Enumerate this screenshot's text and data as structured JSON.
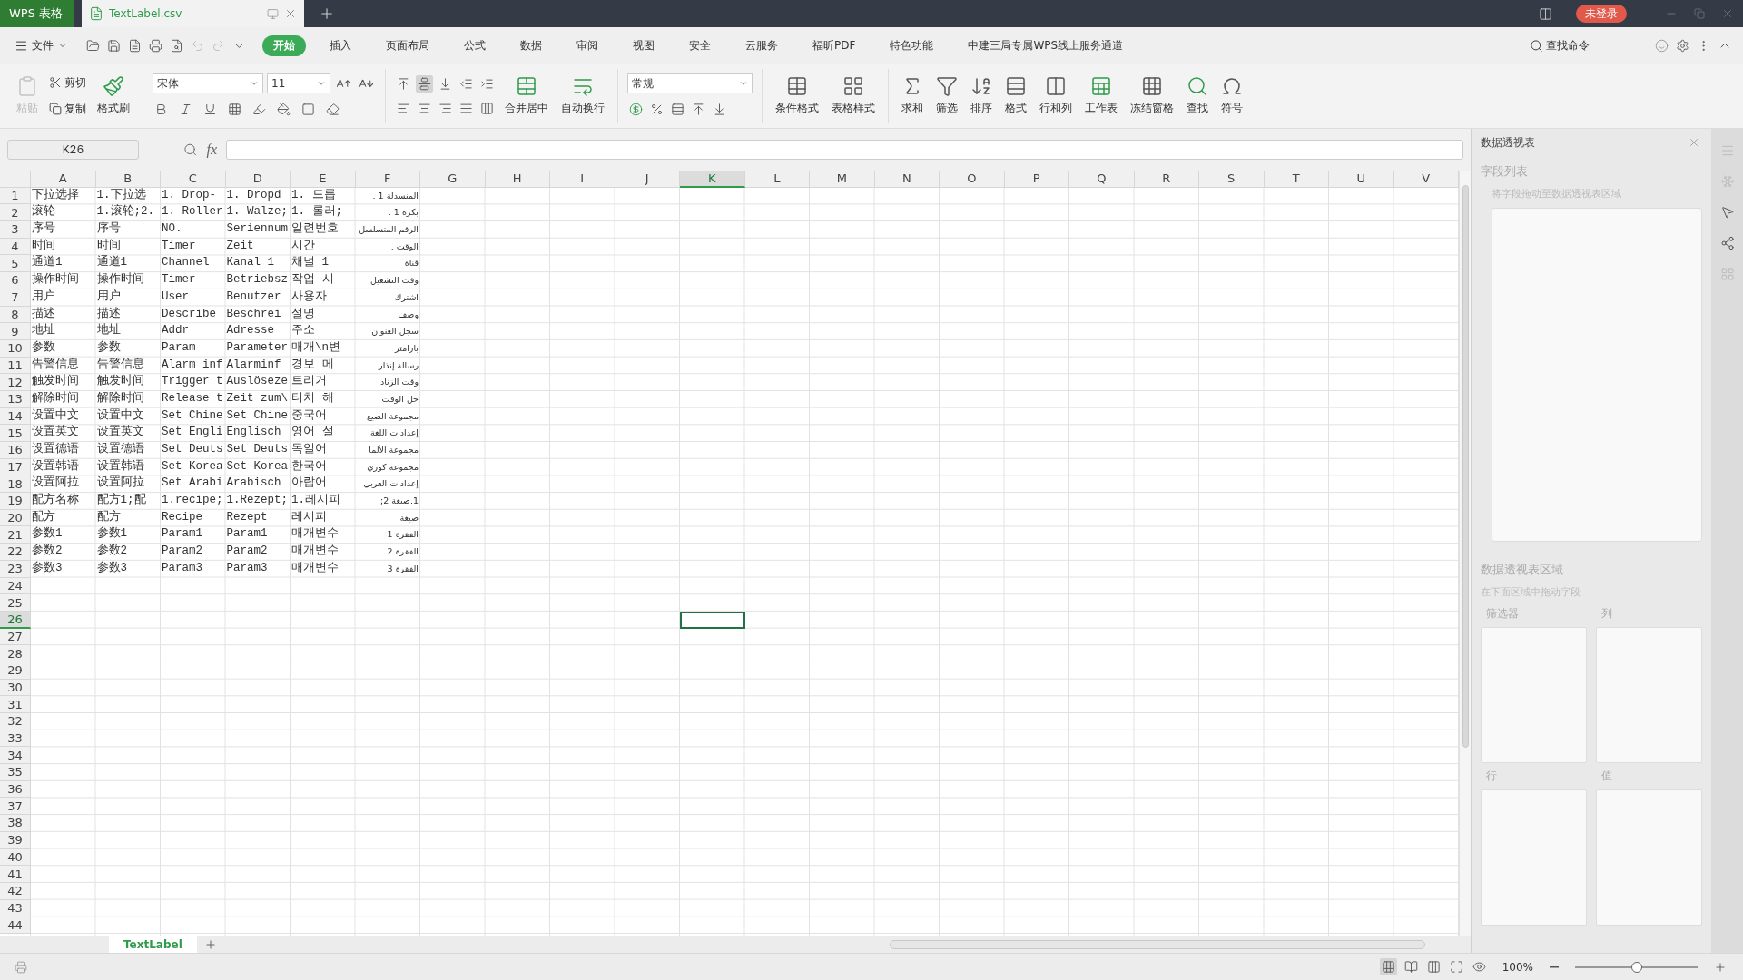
{
  "title_bar": {
    "app_tab": "WPS 表格",
    "doc_tabs": [
      {
        "label": "TextLabel.csv",
        "selected": true
      }
    ],
    "login": "未登录"
  },
  "menu_bar": {
    "file": "文件",
    "tabs": [
      {
        "label": "开始",
        "selected": true
      },
      {
        "label": "插入",
        "selected": false
      },
      {
        "label": "页面布局",
        "selected": false
      },
      {
        "label": "公式",
        "selected": false
      },
      {
        "label": "数据",
        "selected": false
      },
      {
        "label": "审阅",
        "selected": false
      },
      {
        "label": "视图",
        "selected": false
      },
      {
        "label": "安全",
        "selected": false
      },
      {
        "label": "云服务",
        "selected": false
      },
      {
        "label": "福昕PDF",
        "selected": false
      },
      {
        "label": "特色功能",
        "selected": false
      },
      {
        "label": "中建三局专属WPS线上服务通道",
        "selected": false
      }
    ],
    "search": "查找命令"
  },
  "toolbar": {
    "paste": {
      "label": "粘贴",
      "disabled": true
    },
    "cut": "剪切",
    "copy": "复制",
    "format_painter": "格式刷",
    "font": "宋体",
    "font_size": "11",
    "vertical_align": [
      {
        "selected": false
      },
      {
        "selected": true
      },
      {
        "selected": false
      }
    ],
    "merge": "合并居中",
    "wrap": "自动换行",
    "number_format": "常规",
    "tools": [
      "条件格式",
      "表格样式",
      "求和",
      "筛选",
      "排序",
      "格式",
      "行和列",
      "工作表",
      "冻结窗格",
      "查找",
      "符号"
    ]
  },
  "formula_bar": {
    "name_box": "K26",
    "fx": "fx"
  },
  "sheet": {
    "columns": [
      {
        "label": "A",
        "selected": false
      },
      {
        "label": "B",
        "selected": false
      },
      {
        "label": "C",
        "selected": false
      },
      {
        "label": "D",
        "selected": false
      },
      {
        "label": "E",
        "selected": false
      },
      {
        "label": "F",
        "selected": false
      },
      {
        "label": "G",
        "selected": false
      },
      {
        "label": "H",
        "selected": false
      },
      {
        "label": "I",
        "selected": false
      },
      {
        "label": "J",
        "selected": false
      },
      {
        "label": "K",
        "selected": true
      },
      {
        "label": "L",
        "selected": false
      },
      {
        "label": "M",
        "selected": false
      },
      {
        "label": "N",
        "selected": false
      },
      {
        "label": "O",
        "selected": false
      },
      {
        "label": "P",
        "selected": false
      },
      {
        "label": "Q",
        "selected": false
      },
      {
        "label": "R",
        "selected": false
      },
      {
        "label": "S",
        "selected": false
      },
      {
        "label": "T",
        "selected": false
      },
      {
        "label": "U",
        "selected": false
      },
      {
        "label": "V",
        "selected": false
      }
    ],
    "rows": [
      {
        "label": "1",
        "selected": false
      },
      {
        "label": "2",
        "selected": false
      },
      {
        "label": "3",
        "selected": false
      },
      {
        "label": "4",
        "selected": false
      },
      {
        "label": "5",
        "selected": false
      },
      {
        "label": "6",
        "selected": false
      },
      {
        "label": "7",
        "selected": false
      },
      {
        "label": "8",
        "selected": false
      },
      {
        "label": "9",
        "selected": false
      },
      {
        "label": "10",
        "selected": false
      },
      {
        "label": "11",
        "selected": false
      },
      {
        "label": "12",
        "selected": false
      },
      {
        "label": "13",
        "selected": false
      },
      {
        "label": "14",
        "selected": false
      },
      {
        "label": "15",
        "selected": false
      },
      {
        "label": "16",
        "selected": false
      },
      {
        "label": "17",
        "selected": false
      },
      {
        "label": "18",
        "selected": false
      },
      {
        "label": "19",
        "selected": false
      },
      {
        "label": "20",
        "selected": false
      },
      {
        "label": "21",
        "selected": false
      },
      {
        "label": "22",
        "selected": false
      },
      {
        "label": "23",
        "selected": false
      },
      {
        "label": "24",
        "selected": false
      },
      {
        "label": "25",
        "selected": false
      },
      {
        "label": "26",
        "selected": true
      },
      {
        "label": "27",
        "selected": false
      },
      {
        "label": "28",
        "selected": false
      },
      {
        "label": "29",
        "selected": false
      },
      {
        "label": "30",
        "selected": false
      },
      {
        "label": "31",
        "selected": false
      },
      {
        "label": "32",
        "selected": false
      },
      {
        "label": "33",
        "selected": false
      },
      {
        "label": "34",
        "selected": false
      },
      {
        "label": "35",
        "selected": false
      },
      {
        "label": "36",
        "selected": false
      },
      {
        "label": "37",
        "selected": false
      },
      {
        "label": "38",
        "selected": false
      },
      {
        "label": "39",
        "selected": false
      },
      {
        "label": "40",
        "selected": false
      },
      {
        "label": "41",
        "selected": false
      },
      {
        "label": "42",
        "selected": false
      },
      {
        "label": "43",
        "selected": false
      },
      {
        "label": "44",
        "selected": false
      }
    ],
    "cells": [
      [
        "下拉选择",
        "1.下拉选",
        "1. Drop-",
        "1. Dropd",
        "1. 드롭",
        "المنسدلة 1 ."
      ],
      [
        "滚轮",
        "1.滚轮;2.",
        "1. Roller",
        "1. Walze;",
        "1. 롤러;",
        "بكرة 1 ."
      ],
      [
        "序号",
        "序号",
        "NO.",
        "Seriennum",
        "일련번호",
        "الرقم المتسلسل"
      ],
      [
        "时间",
        "时间",
        "Timer",
        "Zeit",
        "시간",
        "الوقت ."
      ],
      [
        "通道1",
        "通道1",
        "Channel",
        "Kanal 1",
        "채널 1",
        "قناة"
      ],
      [
        "操作时间",
        "操作时间",
        "Timer",
        "Betriebsz",
        "작업 시",
        "وقت التشغيل"
      ],
      [
        "用户",
        "用户",
        "User",
        "Benutzer",
        "사용자",
        "اشترك"
      ],
      [
        "描述",
        "描述",
        "Describe",
        "Beschrei",
        "설명",
        "وصف"
      ],
      [
        "地址",
        "地址",
        "Addr",
        "Adresse",
        "주소",
        "سجل العنوان"
      ],
      [
        "参数",
        "参数",
        "Param",
        "Parameter",
        "매개\\n변",
        "بارامتر"
      ],
      [
        "告警信息",
        "告警信息",
        "Alarm inf",
        "Alarminf",
        "경보 메",
        "رسالة إنذار"
      ],
      [
        "触发时间",
        "触发时间",
        "Trigger t",
        "Auslöseze",
        "트리거",
        "وقت الزناد"
      ],
      [
        "解除时间",
        "解除时间",
        "Release t",
        "Zeit zum\\",
        "터치 해",
        "حل الوقت"
      ],
      [
        "设置中文",
        "设置中文",
        "Set Chine",
        "Set Chine",
        "중국어",
        "مجموعة الصيغ"
      ],
      [
        "设置英文",
        "设置英文",
        "Set Engli",
        "Englisch",
        "영어 설",
        "إعدادات اللغة"
      ],
      [
        "设置德语",
        "设置德语",
        "Set Deuts",
        "Set Deuts",
        "독일어",
        "مجموعة الألما"
      ],
      [
        "设置韩语",
        "设置韩语",
        "Set Korea",
        "Set Korea",
        "한국어",
        "مجموعة كوري"
      ],
      [
        "设置阿拉",
        "设置阿拉",
        "Set Arabi",
        "Arabisch",
        "아랍어",
        "إعدادات العربي"
      ],
      [
        "配方名称",
        "配方1;配",
        "1.recipe;",
        "1.Rezept;",
        "1.레시피",
        "1.صيغة 2;"
      ],
      [
        "配方",
        "配方",
        "Recipe",
        "Rezept",
        "레시피",
        "صيغة"
      ],
      [
        "参数1",
        "参数1",
        "Param1",
        "Param1",
        "매개변수",
        "الفقرة 1"
      ],
      [
        "参数2",
        "参数2",
        "Param2",
        "Param2",
        "매개변수",
        "الفقرة 2"
      ],
      [
        "参数3",
        "参数3",
        "Param3",
        "Param3",
        "매개변수",
        "الفقرة 3"
      ]
    ]
  },
  "sheet_tabs": [
    {
      "label": "TextLabel",
      "selected": true
    }
  ],
  "pivot_panel": {
    "title": "数据透视表",
    "field_list_title": "字段列表",
    "field_hint": "将字段拖动至数据透视表区域",
    "area_title": "数据透视表区域",
    "area_hint": "在下面区域中拖动字段",
    "areas": [
      {
        "label": "筛选器"
      },
      {
        "label": "列"
      },
      {
        "label": "行"
      },
      {
        "label": "值"
      }
    ]
  },
  "status_bar": {
    "view_modes": [
      {
        "selected": true
      },
      {
        "selected": false
      },
      {
        "selected": false
      },
      {
        "selected": false
      }
    ],
    "zoom": "100%",
    "zoom_slider": {
      "level": 0.5
    }
  }
}
